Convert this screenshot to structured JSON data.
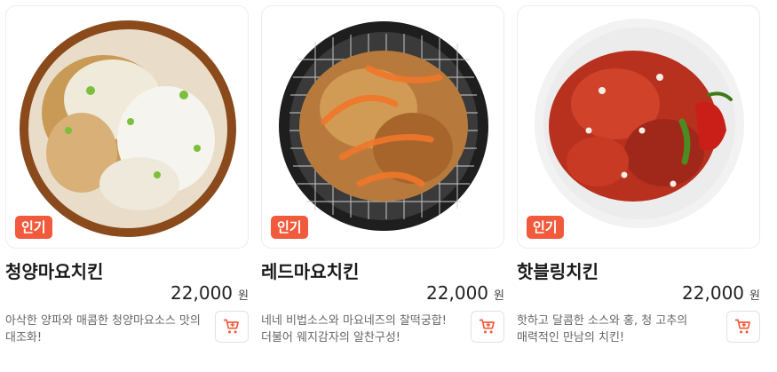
{
  "products": [
    {
      "badge": "인기",
      "name": "청양마요치킨",
      "price": "22,000",
      "currency": "원",
      "description": "아삭한 양파와 매콤한 청양마요소스 맛의 대조화!",
      "image": "mayo-chicken-with-onions"
    },
    {
      "badge": "인기",
      "name": "레드마요치킨",
      "price": "22,000",
      "currency": "원",
      "description": "네네 비법소스와 마요네즈의 찰떡궁합! 더불어 웨지감자의 알찬구성!",
      "image": "red-mayo-chicken-on-grill"
    },
    {
      "badge": "인기",
      "name": "핫블링치킨",
      "price": "22,000",
      "currency": "원",
      "description": "핫하고 달콤한 소스와 홍, 청 고추의 매력적인 만남의 치킨!",
      "image": "hot-red-sauce-chicken"
    }
  ],
  "colors": {
    "badge": "#f15a3c",
    "cart_icon": "#f15a3c"
  },
  "icons": {
    "cart": "cart-icon"
  }
}
